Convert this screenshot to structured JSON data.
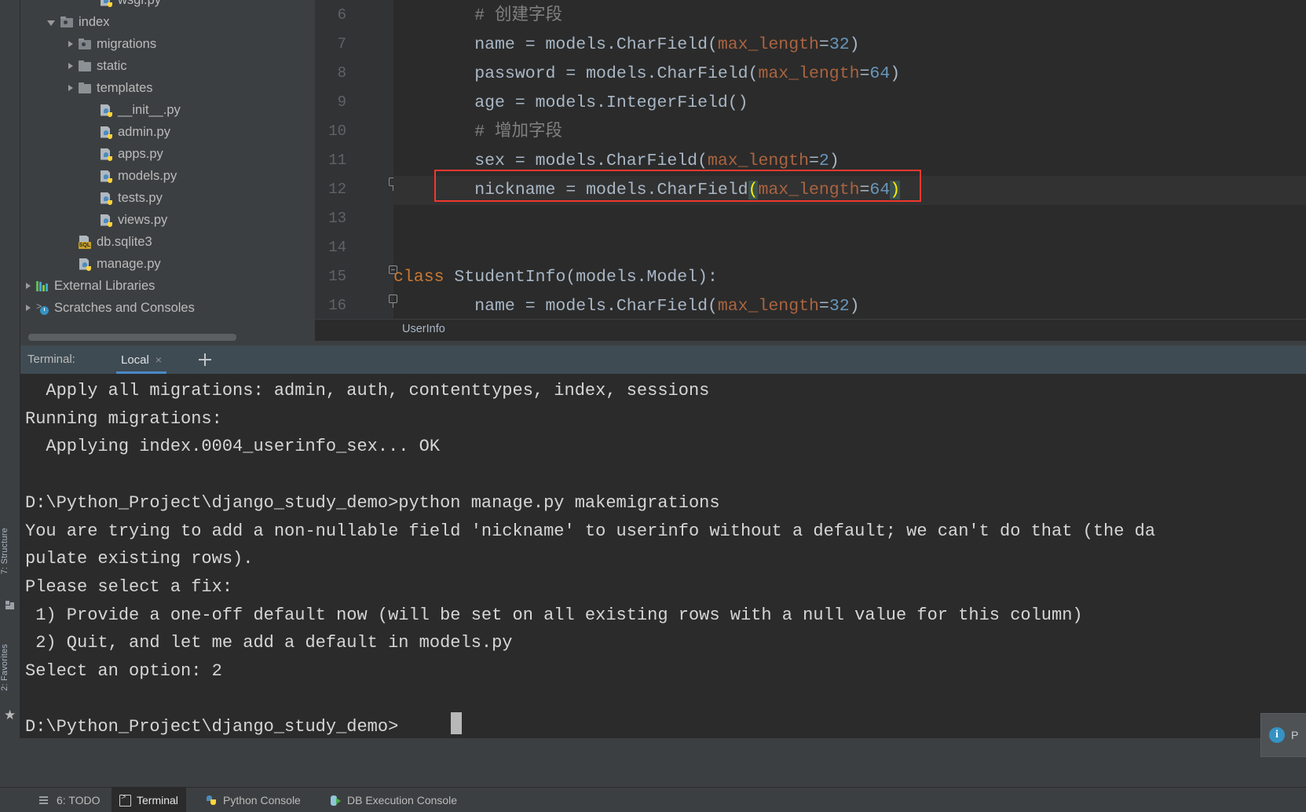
{
  "toolwindows": {
    "structure_label": "7: Structure",
    "favorites_label": "2: Favorites"
  },
  "project_tree": {
    "items": [
      {
        "label": "wsgi.py",
        "icon": "python-file-icon",
        "indent": 4,
        "arrow": "none",
        "partial": true
      },
      {
        "label": "index",
        "icon": "module-folder-icon",
        "indent": 2,
        "arrow": "expanded"
      },
      {
        "label": "migrations",
        "icon": "module-folder-icon",
        "indent": 3,
        "arrow": "collapsed"
      },
      {
        "label": "static",
        "icon": "folder-icon",
        "indent": 3,
        "arrow": "collapsed"
      },
      {
        "label": "templates",
        "icon": "folder-icon",
        "indent": 3,
        "arrow": "collapsed"
      },
      {
        "label": "__init__.py",
        "icon": "python-file-icon",
        "indent": 4,
        "arrow": "none"
      },
      {
        "label": "admin.py",
        "icon": "python-file-icon",
        "indent": 4,
        "arrow": "none"
      },
      {
        "label": "apps.py",
        "icon": "python-file-icon",
        "indent": 4,
        "arrow": "none"
      },
      {
        "label": "models.py",
        "icon": "python-file-icon",
        "indent": 4,
        "arrow": "none"
      },
      {
        "label": "tests.py",
        "icon": "python-file-icon",
        "indent": 4,
        "arrow": "none"
      },
      {
        "label": "views.py",
        "icon": "python-file-icon",
        "indent": 4,
        "arrow": "none"
      },
      {
        "label": "db.sqlite3",
        "icon": "sqlite-file-icon",
        "indent": 3,
        "arrow": "none"
      },
      {
        "label": "manage.py",
        "icon": "python-file-icon",
        "indent": 3,
        "arrow": "none"
      },
      {
        "label": "External Libraries",
        "icon": "libraries-icon",
        "indent": 1,
        "arrow": "collapsed"
      },
      {
        "label": "Scratches and Consoles",
        "icon": "scratches-icon",
        "indent": 1,
        "arrow": "collapsed"
      }
    ]
  },
  "editor": {
    "breadcrumb": "UserInfo",
    "first_visible_line": 6,
    "lines": [
      {
        "no": "6",
        "tokens": [
          {
            "t": "        ",
            "c": "plain"
          },
          {
            "t": "# 创建字段",
            "c": "comment"
          }
        ]
      },
      {
        "no": "7",
        "tokens": [
          {
            "t": "        name = models.CharField(",
            "c": "plain"
          },
          {
            "t": "max_length",
            "c": "param"
          },
          {
            "t": "=",
            "c": "plain"
          },
          {
            "t": "32",
            "c": "num"
          },
          {
            "t": ")",
            "c": "plain"
          }
        ]
      },
      {
        "no": "8",
        "tokens": [
          {
            "t": "        password = models.CharField(",
            "c": "plain"
          },
          {
            "t": "max_length",
            "c": "param"
          },
          {
            "t": "=",
            "c": "plain"
          },
          {
            "t": "64",
            "c": "num"
          },
          {
            "t": ")",
            "c": "plain"
          }
        ]
      },
      {
        "no": "9",
        "tokens": [
          {
            "t": "        age = models.IntegerField()",
            "c": "plain"
          }
        ]
      },
      {
        "no": "10",
        "tokens": [
          {
            "t": "        ",
            "c": "plain"
          },
          {
            "t": "# 增加字段",
            "c": "comment"
          }
        ]
      },
      {
        "no": "11",
        "tokens": [
          {
            "t": "        sex = models.CharField(",
            "c": "plain"
          },
          {
            "t": "max_length",
            "c": "param"
          },
          {
            "t": "=",
            "c": "plain"
          },
          {
            "t": "2",
            "c": "num"
          },
          {
            "t": ")",
            "c": "plain"
          }
        ]
      },
      {
        "no": "12",
        "tokens": [
          {
            "t": "        nickname = models.CharField",
            "c": "plain"
          },
          {
            "t": "(",
            "c": "paren-hl"
          },
          {
            "t": "max_length",
            "c": "param"
          },
          {
            "t": "=",
            "c": "plain"
          },
          {
            "t": "64",
            "c": "num"
          },
          {
            "t": ")",
            "c": "paren-hl"
          }
        ],
        "highlighted": true
      },
      {
        "no": "13",
        "tokens": []
      },
      {
        "no": "14",
        "tokens": []
      },
      {
        "no": "15",
        "tokens": [
          {
            "t": "class",
            "c": "kw"
          },
          {
            "t": " StudentInfo(models.Model):",
            "c": "plain"
          }
        ]
      },
      {
        "no": "16",
        "tokens": [
          {
            "t": "        name = models.CharField(",
            "c": "plain"
          },
          {
            "t": "max_length",
            "c": "param"
          },
          {
            "t": "=",
            "c": "plain"
          },
          {
            "t": "32",
            "c": "num"
          },
          {
            "t": ")",
            "c": "plain"
          }
        ]
      }
    ]
  },
  "terminal_tabs": {
    "title": "Terminal:",
    "tab_label": "Local",
    "close_glyph": "×",
    "add_tab_label": "+"
  },
  "terminal": {
    "lines": [
      "  Apply all migrations: admin, auth, contenttypes, index, sessions",
      "Running migrations:",
      "  Applying index.0004_userinfo_sex... OK",
      "",
      "D:\\Python_Project\\django_study_demo>python manage.py makemigrations",
      "You are trying to add a non-nullable field 'nickname' to userinfo without a default; we can't do that (the da",
      "pulate existing rows).",
      "Please select a fix:",
      " 1) Provide a one-off default now (will be set on all existing rows with a null value for this column)",
      " 2) Quit, and let me add a default in models.py",
      "Select an option: 2",
      "",
      "D:\\Python_Project\\django_study_demo>"
    ],
    "prompt": "D:\\Python_Project\\django_study_demo>",
    "command": "python manage.py makemigrations",
    "selected_option": "2"
  },
  "bottom_bar": {
    "items": [
      {
        "label": "6: TODO",
        "icon": "todo-icon",
        "active": false
      },
      {
        "label": "Terminal",
        "icon": "terminal-icon",
        "active": true
      },
      {
        "label": "Python Console",
        "icon": "python-icon",
        "active": false
      },
      {
        "label": "DB Execution Console",
        "icon": "database-run-icon",
        "active": false
      }
    ]
  },
  "notification": {
    "text": "P",
    "icon": "info-icon"
  },
  "colors": {
    "accent": "#4a88c7",
    "annotation_red": "#f0382e",
    "editor_bg": "#2b2b2b",
    "panel_bg": "#3c3f41",
    "param_orange": "#aa6440",
    "number_blue": "#6897bb",
    "keyword_orange": "#cc7832",
    "bracket_yellow": "#ffee00"
  }
}
